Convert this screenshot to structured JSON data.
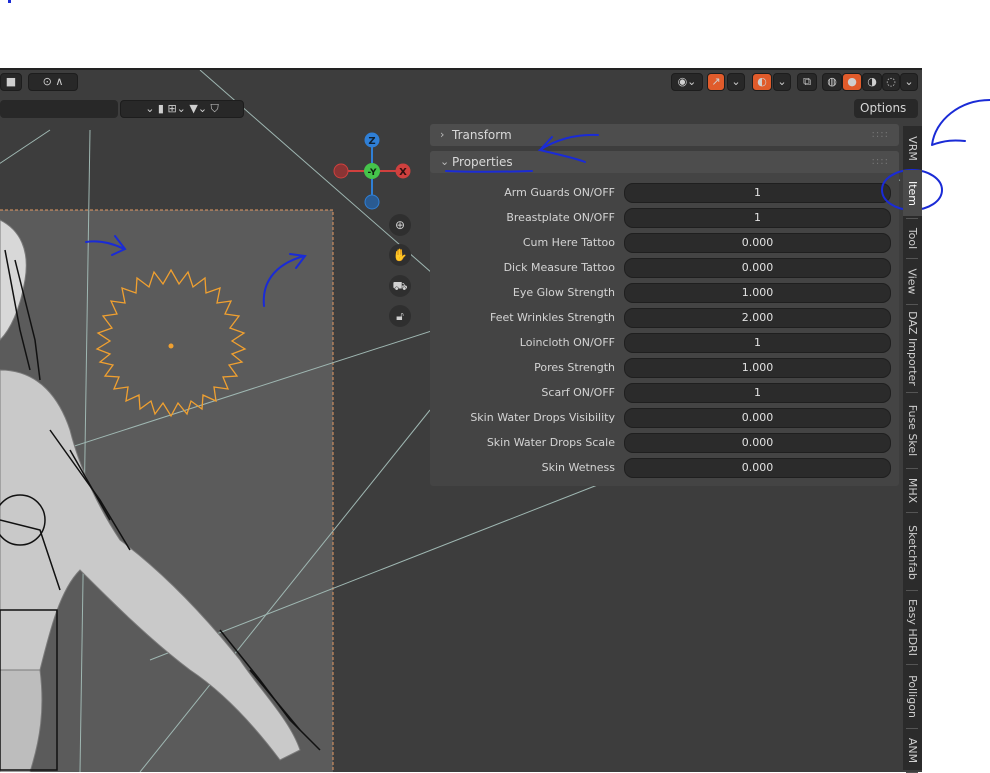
{
  "header": {
    "options_label": "Options"
  },
  "gizmo": {
    "z": "Z",
    "y": "-Y",
    "x": "X"
  },
  "panels": {
    "transform_title": "Transform",
    "properties_title": "Properties"
  },
  "properties": [
    {
      "label": "Arm Guards ON/OFF",
      "value": "1"
    },
    {
      "label": "Breastplate ON/OFF",
      "value": "1"
    },
    {
      "label": "Cum Here Tattoo",
      "value": "0.000"
    },
    {
      "label": "Dick Measure Tattoo",
      "value": "0.000"
    },
    {
      "label": "Eye Glow Strength",
      "value": "1.000"
    },
    {
      "label": "Feet Wrinkles Strength",
      "value": "2.000"
    },
    {
      "label": "Loincloth ON/OFF",
      "value": "1"
    },
    {
      "label": "Pores Strength",
      "value": "1.000"
    },
    {
      "label": "Scarf ON/OFF",
      "value": "1"
    },
    {
      "label": "Skin  Water Drops Visibility",
      "value": "0.000"
    },
    {
      "label": "Skin Water Drops Scale",
      "value": "0.000"
    },
    {
      "label": "Skin Wetness",
      "value": "0.000"
    }
  ],
  "tabs": [
    "VRM",
    "Item",
    "Tool",
    "View",
    "DAZ Importer",
    "Fuse Skel",
    "MHX",
    "Sketchfab",
    "Easy HDRI",
    "Polligon",
    "ANM"
  ],
  "active_tab": "Item",
  "colors": {
    "accent": "#e05b2b",
    "light_outline": "#f0a030",
    "annotation": "#1a2bd6",
    "gizmo_z": "#2f7fd6",
    "gizmo_y": "#45c44b",
    "gizmo_x": "#d0403e"
  }
}
